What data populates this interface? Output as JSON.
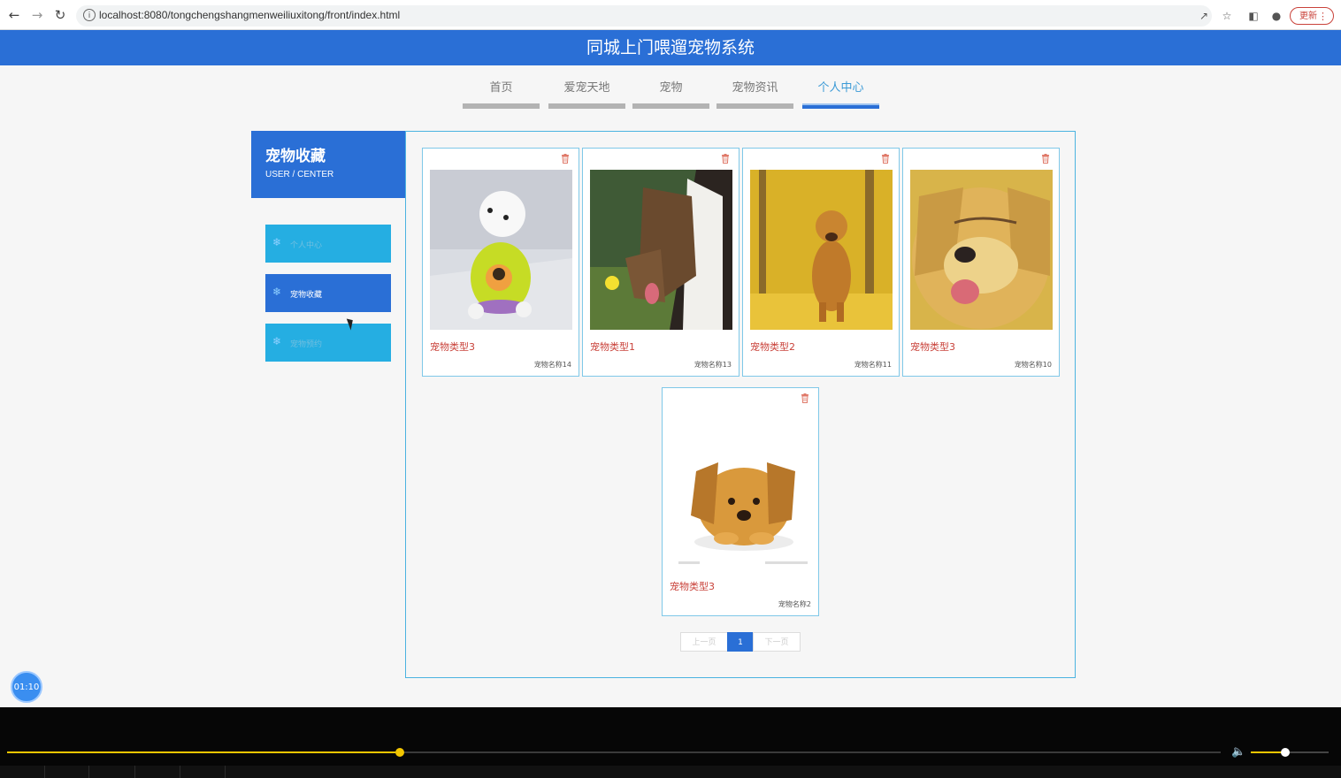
{
  "browser": {
    "url": "localhost:8080/tongchengshangmenweiliuxitong/front/index.html",
    "update_label": "更新"
  },
  "header": {
    "title": "同城上门喂遛宠物系统"
  },
  "nav": {
    "tabs": [
      {
        "label": "首页"
      },
      {
        "label": "爱宠天地"
      },
      {
        "label": "宠物"
      },
      {
        "label": "宠物资讯"
      },
      {
        "label": "个人中心"
      }
    ],
    "active_index": 4
  },
  "sidebar": {
    "title": "宠物收藏",
    "subtitle": "USER / CENTER",
    "items": [
      {
        "label": "个人中心"
      },
      {
        "label": "宠物收藏"
      },
      {
        "label": "宠物预约"
      }
    ],
    "active_index": 1
  },
  "cards": [
    {
      "type": "宠物类型3",
      "name": "宠物名称14",
      "image": "white-poodle-in-green-shirt"
    },
    {
      "type": "宠物类型1",
      "name": "宠物名称13",
      "image": "collie-dog"
    },
    {
      "type": "宠物类型2",
      "name": "宠物名称11",
      "image": "golden-retriever-autumn"
    },
    {
      "type": "宠物类型3",
      "name": "宠物名称10",
      "image": "smiling-golden-retriever"
    },
    {
      "type": "宠物类型3",
      "name": "宠物名称2",
      "image": "golden-puppy-lying"
    }
  ],
  "pager": {
    "prev": "上一页",
    "current": "1",
    "next": "下一页"
  },
  "video": {
    "time": "01:10",
    "progress": 0.32,
    "volume": 0.4
  },
  "colors": {
    "header_blue": "#2a6fd6",
    "menu_cyan": "#25aee2",
    "type_red": "#c9423a"
  }
}
